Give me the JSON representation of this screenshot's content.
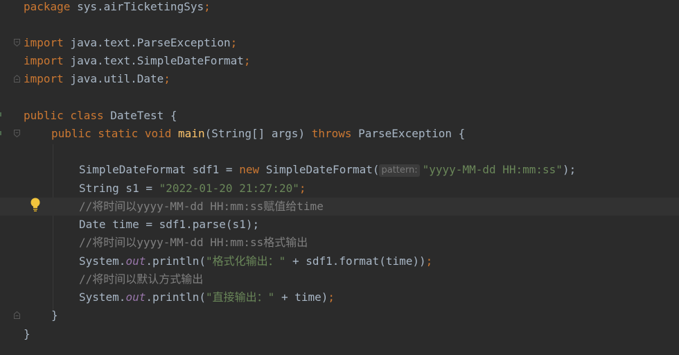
{
  "editor": {
    "lines": [
      {
        "t": "package_line",
        "pkg_kw": "package",
        "pkg_name": " sys.airTicketingSys",
        "semi": ";"
      },
      {
        "t": "blank"
      },
      {
        "t": "import",
        "kw": "import",
        "name": " java.text.ParseException",
        "semi": ";"
      },
      {
        "t": "import",
        "kw": "import",
        "name": " java.text.SimpleDateFormat",
        "semi": ";"
      },
      {
        "t": "import",
        "kw": "import",
        "name": " java.util.Date",
        "semi": ";"
      },
      {
        "t": "blank"
      }
    ],
    "package_kw": "package",
    "package_name": " sys.airTicketingSys",
    "semi": ";",
    "import_kw": "import",
    "import1": " java.text.ParseException",
    "import2": " java.text.SimpleDateFormat",
    "import3": " java.util.Date",
    "class_decl": {
      "kw1": "public",
      "kw2": " class",
      "name": " DateTest {"
    },
    "main_decl": {
      "kw1": "public",
      "kw2": " static",
      "kw3": " void",
      "fn": " main",
      "params": "(String[] args) ",
      "throws": "throws",
      "exc": " ParseException {"
    },
    "line_sdf": {
      "pre": "SimpleDateFormat sdf1 = ",
      "new_kw": "new",
      "ctor": " SimpleDateFormat(",
      "hint": "pattern:",
      "arg": "\"yyyy-MM-dd HH:mm:ss\"",
      "post": ");"
    },
    "line_s1": {
      "pre": "String s1 = ",
      "str": "\"2022-01-20 21:27:20\"",
      "semi": ";"
    },
    "comment1": "//将时间以yyyy-MM-dd HH:mm:ss赋值给time",
    "line_time": "Date time = sdf1.parse(s1);",
    "comment2": "//将时间以yyyy-MM-dd HH:mm:ss格式输出",
    "line_print1": {
      "sys": "System.",
      "out": "out",
      "call": ".println(",
      "str": "\"格式化输出：\"",
      "rest": " + sdf1.format(time))",
      "semi": ";"
    },
    "comment3": "//将时间以默认方式输出",
    "line_print2": {
      "sys": "System.",
      "out": "out",
      "call": ".println(",
      "str": "\"直接输出：\"",
      "rest": " + time)",
      "semi": ";"
    },
    "close_method": "}",
    "close_class": "}"
  },
  "colors": {
    "background": "#2b2b2b",
    "keyword": "#cc7832",
    "function": "#ffc66d",
    "string": "#6a8759",
    "comment": "#808080",
    "field": "#9876aa",
    "default": "#a9b7c6"
  },
  "icons": [
    "fold-icon",
    "lightbulb-icon"
  ]
}
